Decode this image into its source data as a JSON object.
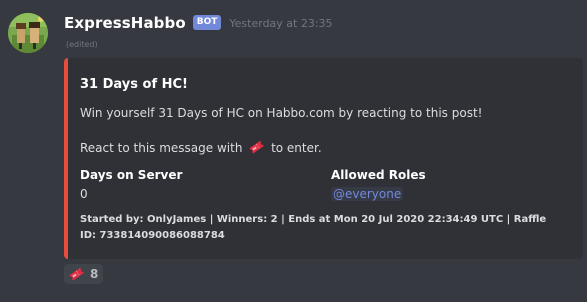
{
  "message": {
    "author": "ExpressHabbo",
    "bot_tag": "BOT",
    "timestamp": "Yesterday at 23:35",
    "edited_label": "(edited)"
  },
  "embed": {
    "accent_color": "#e74c3c",
    "title": "31 Days of HC!",
    "description_line1": "Win yourself 31 Days of HC on Habbo.com by reacting to this post!",
    "description_line2_before": "React to this message with",
    "description_emoji": "ticket-icon",
    "description_line2_after": "to enter.",
    "fields": [
      {
        "name": "Days on Server",
        "value": "0"
      },
      {
        "name": "Allowed Roles",
        "value": "@everyone"
      }
    ],
    "footer": "Started by: OnlyJames | Winners: 2 | Ends at Mon 20 Jul 2020 22:34:49 UTC | Raffle ID: 733814090086088784"
  },
  "reactions": [
    {
      "emoji": "ticket-icon",
      "count": "8"
    }
  ],
  "colors": {
    "background": "#36393f",
    "embed_background": "#2f3136",
    "bot_tag": "#7289da",
    "mention": "#7289da"
  }
}
